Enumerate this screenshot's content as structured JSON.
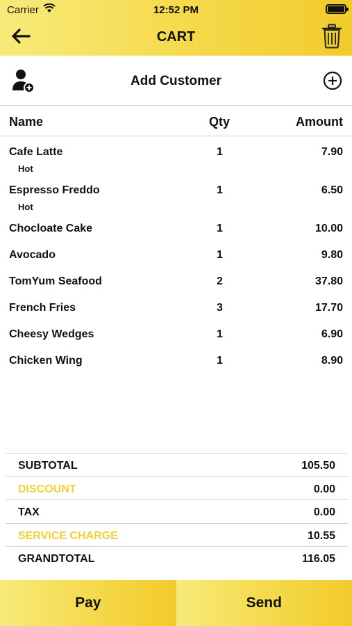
{
  "status_bar": {
    "carrier": "Carrier",
    "time": "12:52 PM"
  },
  "header": {
    "title": "CART"
  },
  "customer": {
    "label": "Add Customer"
  },
  "table": {
    "columns": {
      "name": "Name",
      "qty": "Qty",
      "amount": "Amount"
    },
    "items": [
      {
        "name": "Cafe Latte",
        "option": "Hot",
        "qty": "1",
        "amount": "7.90"
      },
      {
        "name": "Espresso Freddo",
        "option": "Hot",
        "qty": "1",
        "amount": "6.50"
      },
      {
        "name": "Chocloate Cake",
        "qty": "1",
        "amount": "10.00"
      },
      {
        "name": "Avocado",
        "qty": "1",
        "amount": "9.80"
      },
      {
        "name": "TomYum Seafood",
        "qty": "2",
        "amount": "37.80"
      },
      {
        "name": "French Fries",
        "qty": "3",
        "amount": "17.70"
      },
      {
        "name": "Cheesy Wedges",
        "qty": "1",
        "amount": "6.90"
      },
      {
        "name": "Chicken Wing",
        "qty": "1",
        "amount": "8.90"
      }
    ]
  },
  "totals": {
    "subtotal": {
      "label": "SUBTOTAL",
      "value": "105.50"
    },
    "discount": {
      "label": "DISCOUNT",
      "value": "0.00"
    },
    "tax": {
      "label": "TAX",
      "value": "0.00"
    },
    "service_charge": {
      "label": "SERVICE CHARGE",
      "value": "10.55"
    },
    "grandtotal": {
      "label": "GRANDTOTAL",
      "value": "116.05"
    }
  },
  "actions": {
    "pay": "Pay",
    "send": "Send"
  },
  "colors": {
    "accent": "#f5d94a",
    "accent_text": "#f2cf38"
  }
}
